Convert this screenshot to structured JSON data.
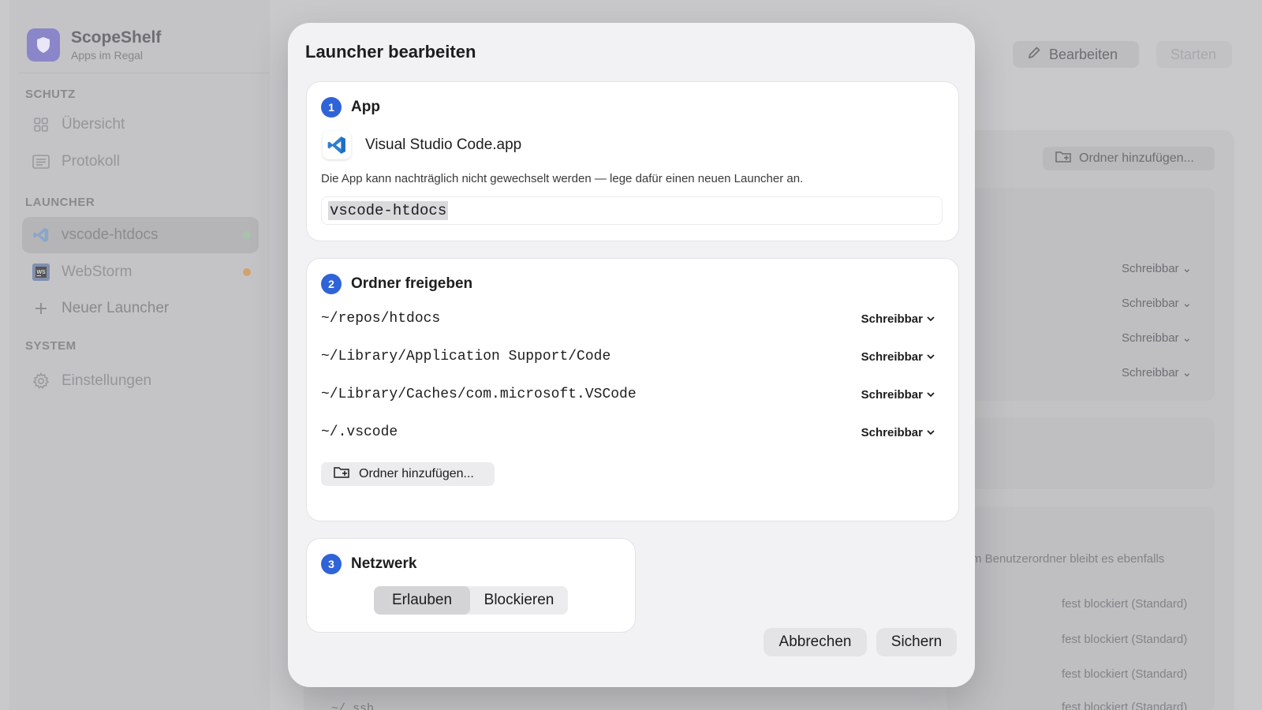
{
  "sidebar": {
    "app_name": "ScopeShelf",
    "app_subtitle": "Apps im Regal",
    "sections": {
      "schutz": "SCHUTZ",
      "launcher": "LAUNCHER",
      "system": "SYSTEM"
    },
    "items": [
      {
        "label": "Übersicht",
        "icon": "grid-icon"
      },
      {
        "label": "Protokoll",
        "icon": "log-icon"
      },
      {
        "label": "vscode-htdocs",
        "icon": "vscode-icon",
        "status_color": "#a8c3ab"
      },
      {
        "label": "WebStorm",
        "icon": "webstorm-icon",
        "status_color": "#d4a26c"
      },
      {
        "label": "Neuer Launcher",
        "icon": "plus-icon"
      },
      {
        "label": "Einstellungen",
        "icon": "gear-icon"
      }
    ]
  },
  "main": {
    "edit_label": "Bearbeiten",
    "start_label": "Starten",
    "add_folder_label": "Ordner hinzufügen...",
    "modes": [
      "Schreibbar",
      "Schreibbar",
      "Schreibbar",
      "Schreibbar"
    ],
    "note_fragment": "m Benutzerordner bleibt es ebenfalls",
    "blocked": [
      "fest blockiert (Standard)",
      "fest blockiert (Standard)",
      "fest blockiert (Standard)",
      "fest blockiert (Standard)"
    ],
    "partial_path": "~/.ssh"
  },
  "modal": {
    "title": "Launcher bearbeiten",
    "app_section": {
      "number": "1",
      "title": "App",
      "app_name": "Visual Studio Code.app",
      "note": "Die App kann nachträglich nicht gewechselt werden — lege dafür einen neuen Launcher an.",
      "launcher_name": "vscode-htdocs"
    },
    "folders_section": {
      "number": "2",
      "title": "Ordner freigeben",
      "folders": [
        {
          "path": "~/repos/htdocs",
          "mode": "Schreibbar"
        },
        {
          "path": "~/Library/Application Support/Code",
          "mode": "Schreibbar"
        },
        {
          "path": "~/Library/Caches/com.microsoft.VSCode",
          "mode": "Schreibbar"
        },
        {
          "path": "~/.vscode",
          "mode": "Schreibbar"
        }
      ],
      "add_folder_label": "Ordner hinzufügen..."
    },
    "network_section": {
      "number": "3",
      "title": "Netzwerk",
      "options": [
        "Erlauben",
        "Blockieren"
      ],
      "selected": "Erlauben"
    },
    "cancel_label": "Abbrechen",
    "save_label": "Sichern"
  },
  "colors": {
    "accent": "#2f63d8",
    "overlay": "#c9c9cc",
    "modal_bg": "#f2f2f4"
  }
}
